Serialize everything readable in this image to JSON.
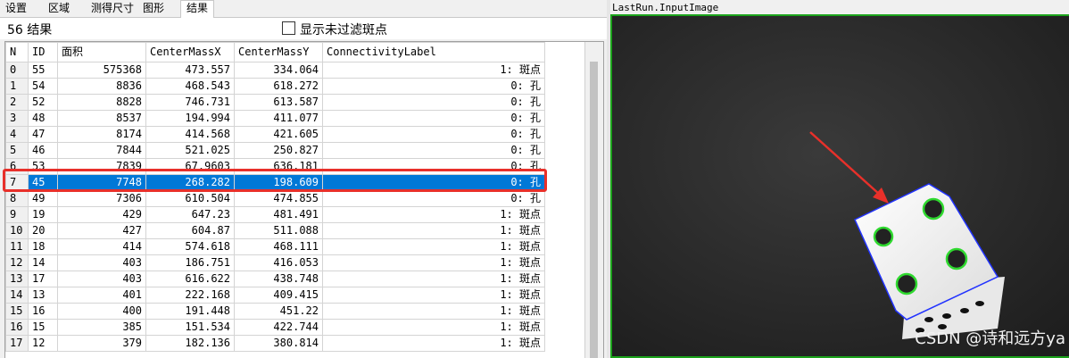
{
  "tabs": [
    "设置",
    "区域",
    "测得尺寸",
    "图形",
    "结果"
  ],
  "active_tab": 4,
  "result_count": "56 结果",
  "show_unfiltered_label": "显示未过滤斑点",
  "show_unfiltered_checked": false,
  "table": {
    "columns": [
      "N",
      "ID",
      "面积",
      "CenterMassX",
      "CenterMassY",
      "ConnectivityLabel"
    ],
    "selected_row": 7,
    "rows": [
      [
        "0",
        "55",
        "575368",
        "473.557",
        "334.064",
        "1: 斑点"
      ],
      [
        "1",
        "54",
        "8836",
        "468.543",
        "618.272",
        "0: 孔"
      ],
      [
        "2",
        "52",
        "8828",
        "746.731",
        "613.587",
        "0: 孔"
      ],
      [
        "3",
        "48",
        "8537",
        "194.994",
        "411.077",
        "0: 孔"
      ],
      [
        "4",
        "47",
        "8174",
        "414.568",
        "421.605",
        "0: 孔"
      ],
      [
        "5",
        "46",
        "7844",
        "521.025",
        "250.827",
        "0: 孔"
      ],
      [
        "6",
        "53",
        "7839",
        "67.9603",
        "636.181",
        "0: 孔"
      ],
      [
        "7",
        "45",
        "7748",
        "268.282",
        "198.609",
        "0: 孔"
      ],
      [
        "8",
        "49",
        "7306",
        "610.504",
        "474.855",
        "0: 孔"
      ],
      [
        "9",
        "19",
        "429",
        "647.23",
        "481.491",
        "1: 斑点"
      ],
      [
        "10",
        "20",
        "427",
        "604.87",
        "511.088",
        "1: 斑点"
      ],
      [
        "11",
        "18",
        "414",
        "574.618",
        "468.111",
        "1: 斑点"
      ],
      [
        "12",
        "14",
        "403",
        "186.751",
        "416.053",
        "1: 斑点"
      ],
      [
        "13",
        "17",
        "403",
        "616.622",
        "438.748",
        "1: 斑点"
      ],
      [
        "14",
        "13",
        "401",
        "222.168",
        "409.415",
        "1: 斑点"
      ],
      [
        "15",
        "16",
        "400",
        "191.448",
        "451.22",
        "1: 斑点"
      ],
      [
        "16",
        "15",
        "385",
        "151.534",
        "422.744",
        "1: 斑点"
      ],
      [
        "17",
        "12",
        "379",
        "182.136",
        "380.814",
        "1: 斑点"
      ]
    ]
  },
  "image_panel": {
    "title": "LastRun.InputImage",
    "watermark": "CSDN @诗和远方ya"
  },
  "colors": {
    "selection": "#0078d7",
    "highlight_box": "#e8302a",
    "image_border": "#1ba31b",
    "blob_outline": "#2fd92f",
    "dice_outline": "#2233ff",
    "arrow": "#e8302a"
  }
}
